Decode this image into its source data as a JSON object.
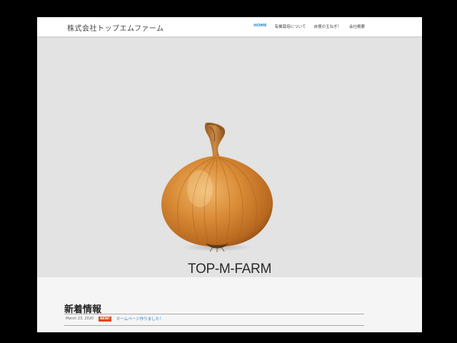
{
  "header": {
    "brand": "株式会社トップエムファーム",
    "nav": [
      {
        "label": "HOME",
        "active": true
      },
      {
        "label": "有機栽培について",
        "active": false
      },
      {
        "label": "自慢の玉ねぎ！",
        "active": false
      },
      {
        "label": "会社概要",
        "active": false
      }
    ]
  },
  "hero": {
    "title": "TOP-M-FARM",
    "image": "onion"
  },
  "news": {
    "heading": "新着情報",
    "items": [
      {
        "date": "March 23, 2020",
        "badge": "NEW!",
        "text": "ホームページ作りました！"
      }
    ]
  },
  "colors": {
    "accent": "#2e8fd6",
    "badge": "#e0451f",
    "hero_bg": "#e2e3e2"
  }
}
